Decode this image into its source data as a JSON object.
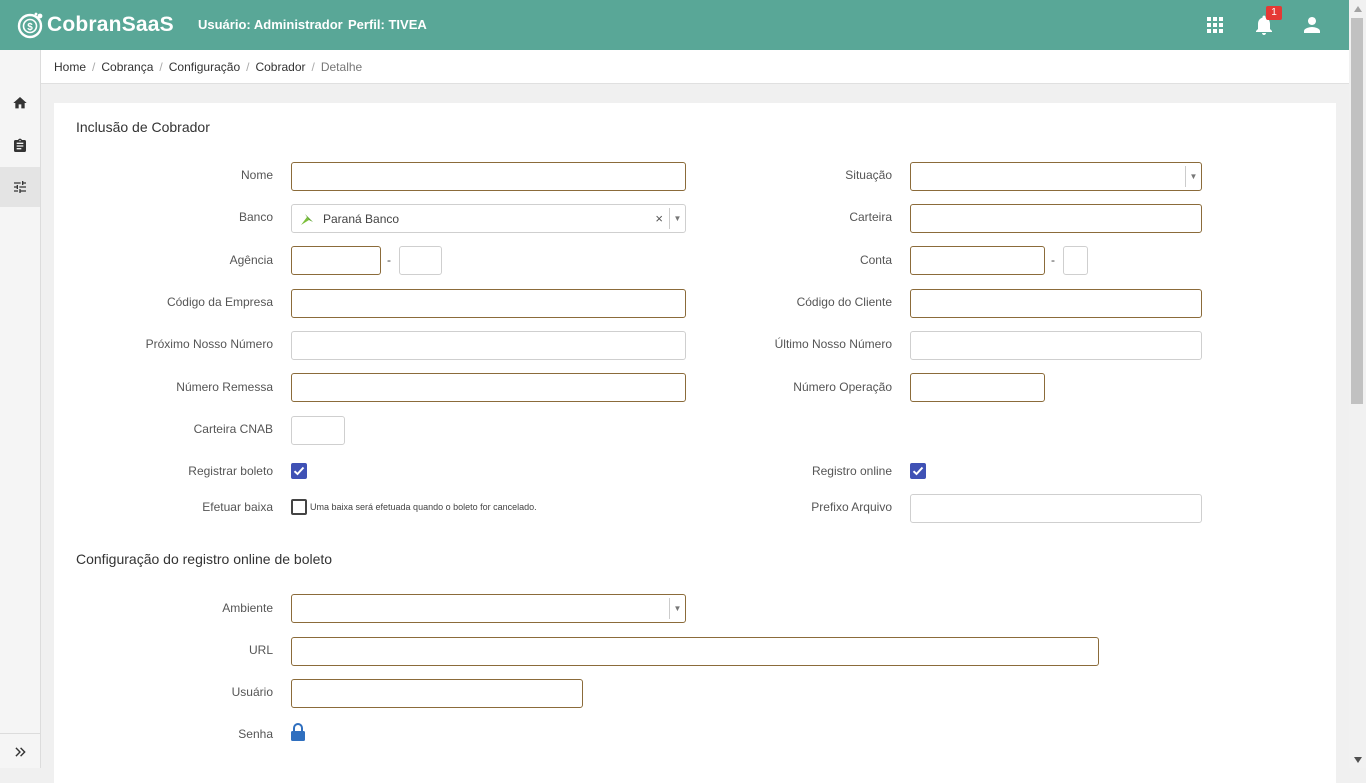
{
  "header": {
    "logo_text": "CobranSaaS",
    "user_label": "Usuário:",
    "user_value": "Administrador",
    "profile_label": "Perfil:",
    "profile_value": "TIVEA",
    "notification_count": "1",
    "icons": [
      "apps-grid-icon",
      "bell-icon",
      "user-icon"
    ]
  },
  "sidebar": {
    "items": [
      {
        "icon": "home-icon"
      },
      {
        "icon": "clipboard-icon"
      },
      {
        "icon": "sliders-icon",
        "active": true
      }
    ],
    "expand_icon": "double-chevron-right-icon"
  },
  "breadcrumb": [
    "Home",
    "Cobrança",
    "Configuração",
    "Cobrador",
    "Detalhe"
  ],
  "form": {
    "title": "Inclusão de Cobrador",
    "labels": {
      "nome": "Nome",
      "situacao": "Situação",
      "banco": "Banco",
      "carteira": "Carteira",
      "agencia": "Agência",
      "conta": "Conta",
      "codigo_empresa": "Código da Empresa",
      "codigo_cliente": "Código do Cliente",
      "proximo_nosso_numero": "Próximo Nosso Número",
      "ultimo_nosso_numero": "Último Nosso Número",
      "numero_remessa": "Número Remessa",
      "numero_operacao": "Número Operação",
      "carteira_cnab": "Carteira CNAB",
      "registrar_boleto": "Registrar boleto",
      "registro_online": "Registro online",
      "efetuar_baixa": "Efetuar baixa",
      "prefixo_arquivo": "Prefixo Arquivo"
    },
    "values": {
      "nome": "",
      "situacao": "",
      "banco": "Paraná Banco",
      "carteira": "",
      "agencia": "",
      "agencia_digito": "",
      "conta": "",
      "conta_digito": "",
      "codigo_empresa": "",
      "codigo_cliente": "",
      "proximo_nosso_numero": "",
      "ultimo_nosso_numero": "",
      "numero_remessa": "",
      "numero_operacao": "",
      "carteira_cnab": "",
      "prefixo_arquivo": ""
    },
    "checks": {
      "registrar_boleto": true,
      "registro_online": true,
      "efetuar_baixa": false
    },
    "efetuar_baixa_hint": "Uma baixa será efetuada quando o boleto for cancelado.",
    "dash": "-",
    "clear_symbol": "×",
    "dropdown_symbol": "▼"
  },
  "online_config": {
    "title": "Configuração do registro online de boleto",
    "labels": {
      "ambiente": "Ambiente",
      "url": "URL",
      "usuario": "Usuário",
      "senha": "Senha"
    },
    "values": {
      "ambiente": "",
      "url": "",
      "usuario": ""
    },
    "senha_icon": "lock-icon"
  },
  "colors": {
    "topbar": "#59a797",
    "input_border": "#8b6b3a",
    "checkbox": "#3f51b5",
    "badge": "#e53935",
    "lock": "#2f6fbf"
  }
}
